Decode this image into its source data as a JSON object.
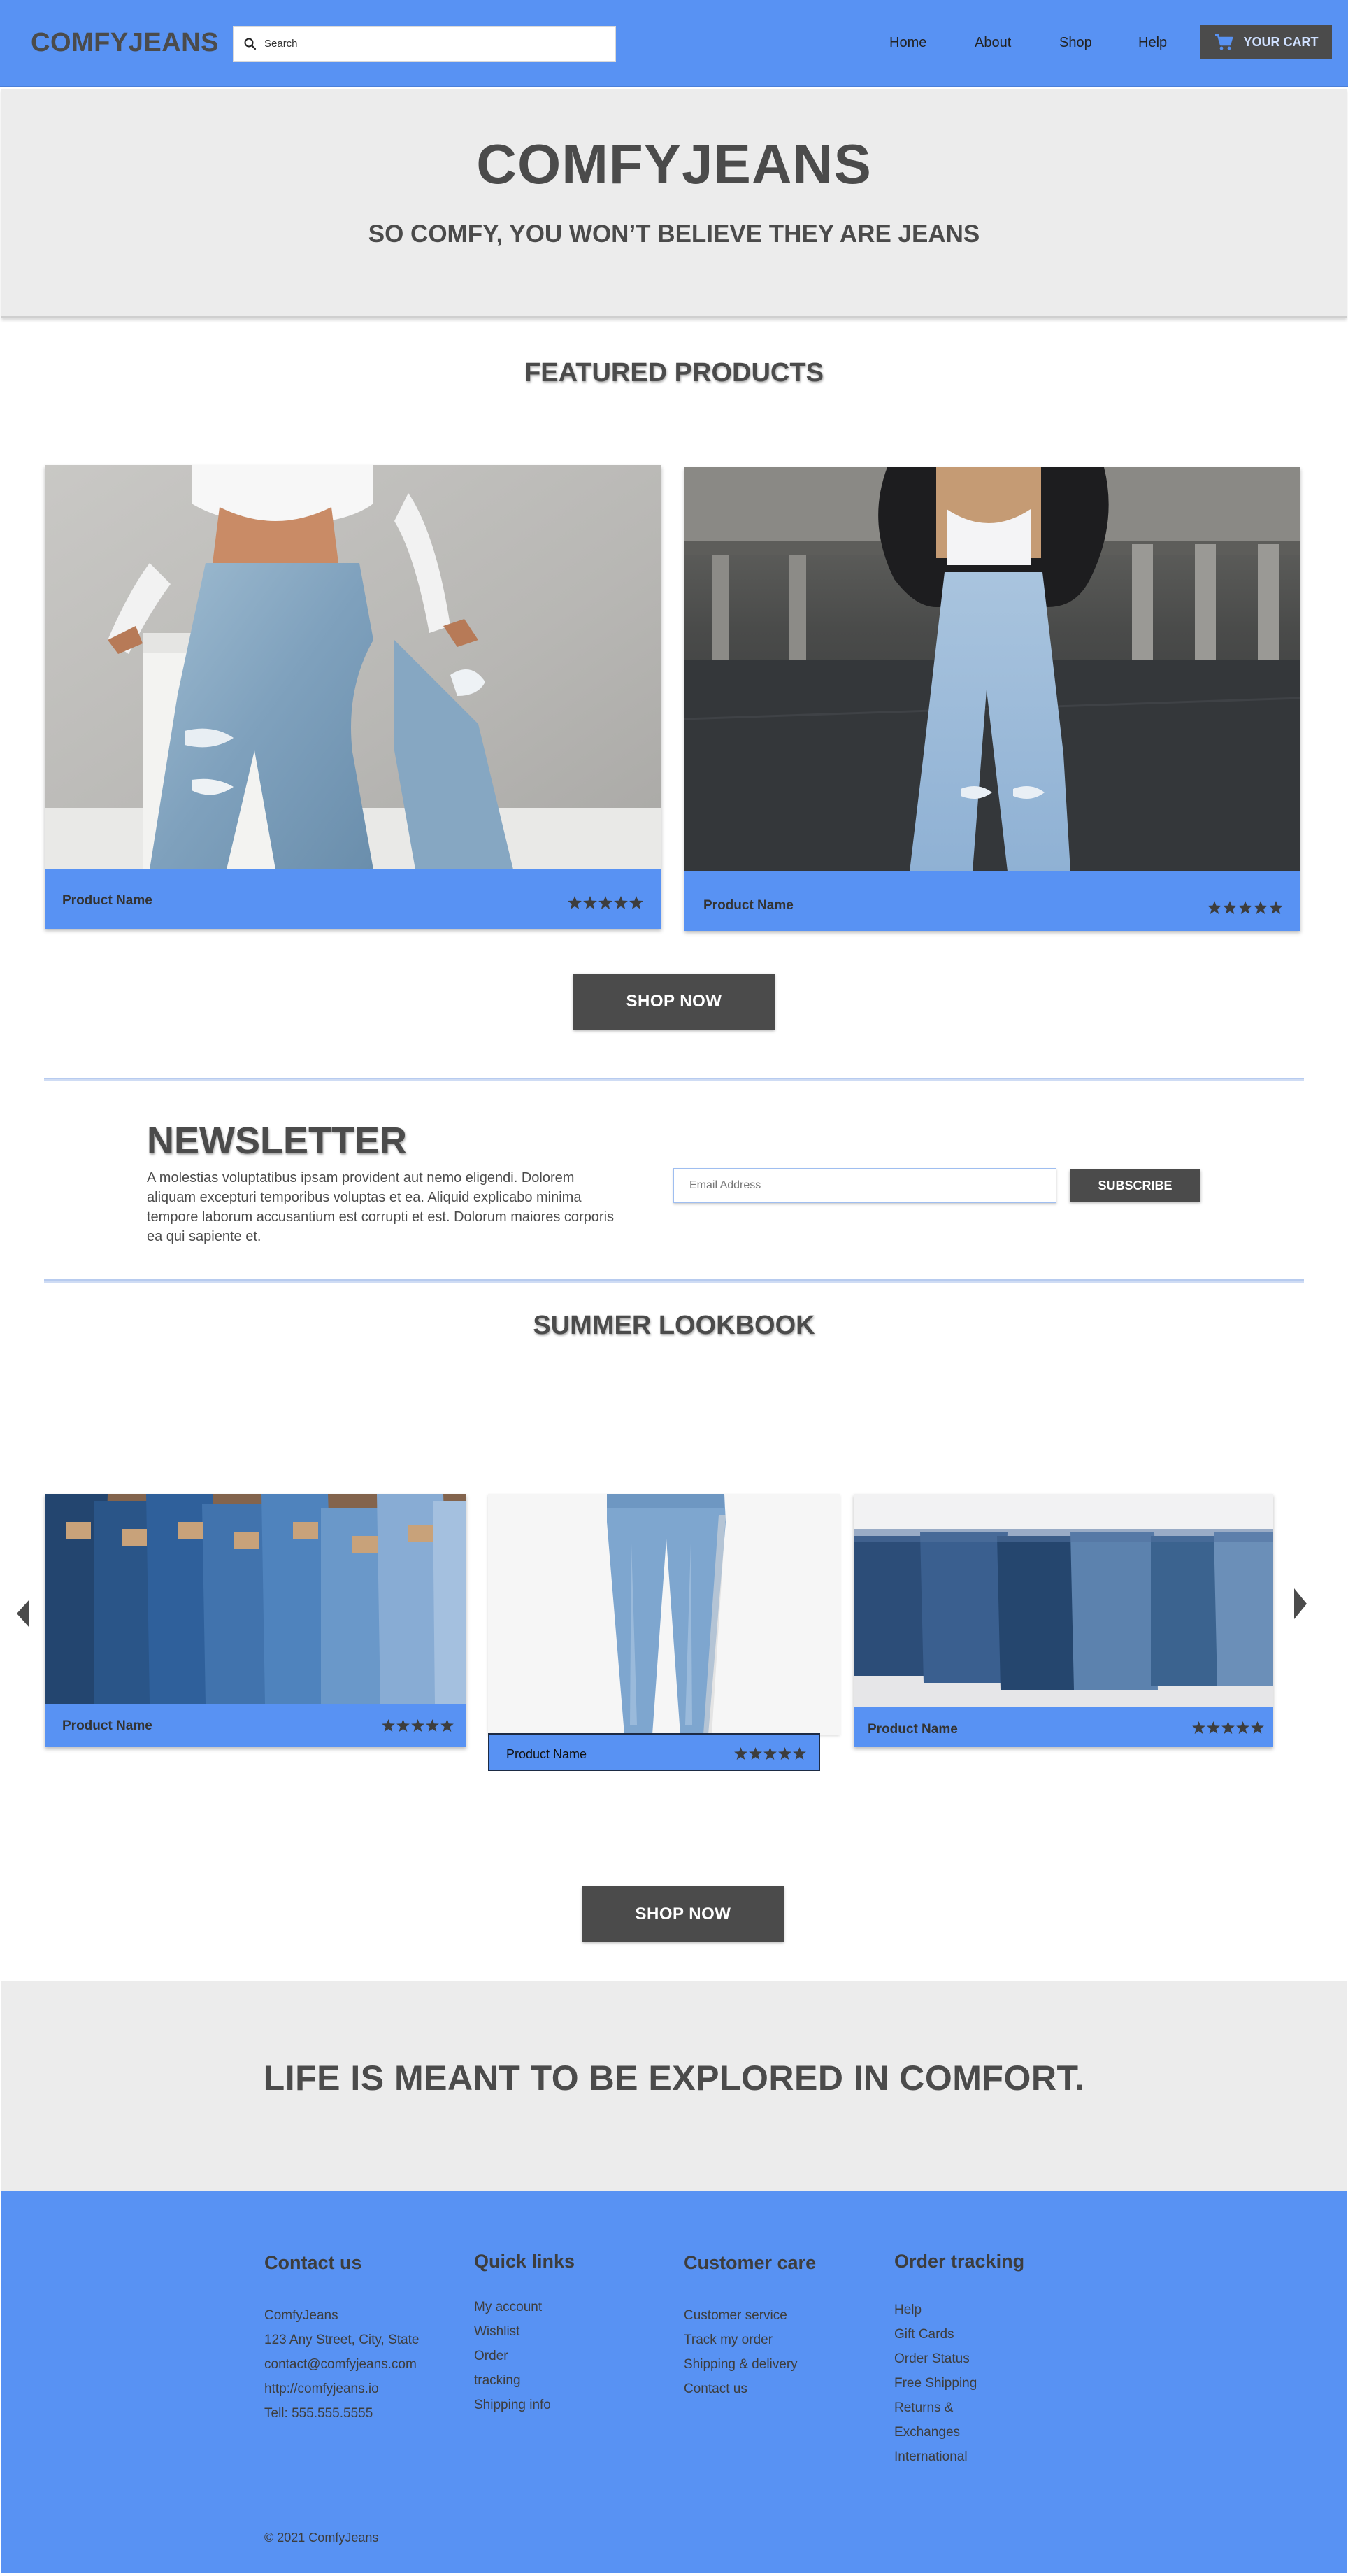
{
  "header": {
    "logo": "COMFYJEANS",
    "search_placeholder": "Search",
    "nav": [
      "Home",
      "About",
      "Shop",
      "Help"
    ],
    "cart_label": "YOUR CART"
  },
  "hero": {
    "title": "COMFYJEANS",
    "subtitle": "SO COMFY, YOU WON’T BELIEVE THEY ARE JEANS"
  },
  "featured": {
    "title": "FEATURED PRODUCTS",
    "products": [
      {
        "name": "Product Name",
        "rating": 5
      },
      {
        "name": "Product Name",
        "rating": 5
      }
    ],
    "shop_button": "SHOP NOW"
  },
  "newsletter": {
    "title": "NEWSLETTER",
    "text": "A molestias voluptatibus ipsam provident aut nemo eligendi. Dolorem aliquam excepturi temporibus voluptas et ea. Aliquid explicabo minima tempore laborum accusantium est corrupti et est. Dolorum maiores corporis ea qui sapiente et.",
    "email_placeholder": "Email Address",
    "subscribe_label": "SUBSCRIBE"
  },
  "lookbook": {
    "title": "SUMMER LOOKBOOK",
    "products": [
      {
        "name": "Product Name",
        "rating": 5
      },
      {
        "name": "Product Name",
        "rating": 5
      },
      {
        "name": "Product Name",
        "rating": 5
      }
    ],
    "shop_button": "SHOP NOW"
  },
  "tagline": "LIFE IS MEANT TO BE EXPLORED IN COMFORT.",
  "footer": {
    "columns": [
      {
        "title": "Contact us",
        "items": [
          "ComfyJeans",
          "123 Any Street, City, State",
          "contact@comfyjeans.com",
          "http://comfyjeans.io",
          "Tell: 555.555.5555"
        ]
      },
      {
        "title": "Quick links",
        "items": [
          "My account",
          "Wishlist",
          "Order",
          "tracking",
          "Shipping info"
        ]
      },
      {
        "title": "Customer care",
        "items": [
          "Customer service",
          "Track my order",
          "Shipping & delivery",
          "Contact us"
        ]
      },
      {
        "title": "Order tracking",
        "items": [
          "Help",
          "Gift Cards",
          "Order Status",
          "Free Shipping",
          "Returns &",
          "Exchanges",
          "International"
        ]
      }
    ],
    "copyright": "© 2021 ComfyJeans"
  },
  "colors": {
    "brand_blue": "#5892f3",
    "dark_gray": "#4b4b4b",
    "light_gray": "#ececec"
  },
  "icons": [
    "search-icon",
    "cart-icon",
    "star-icon",
    "arrow-left-icon",
    "arrow-right-icon"
  ]
}
